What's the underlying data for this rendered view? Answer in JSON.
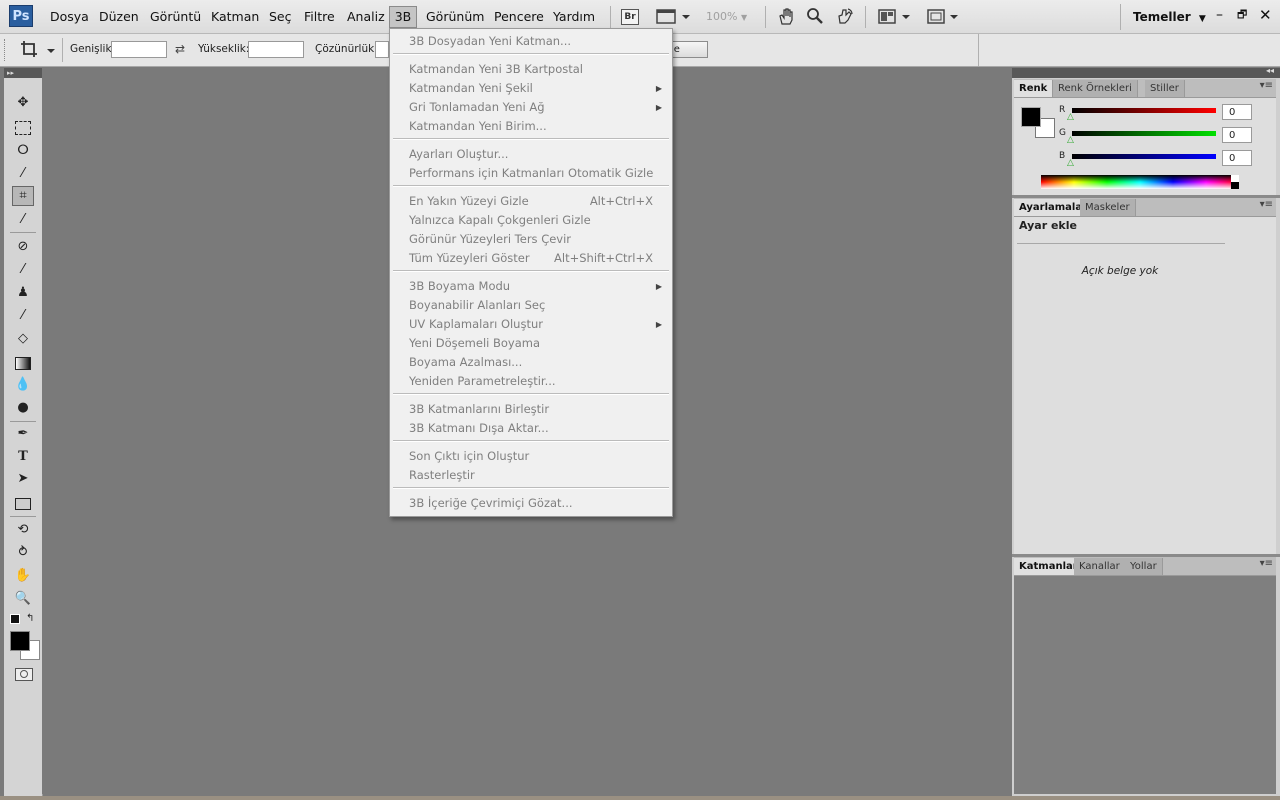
{
  "app": {
    "logo": "Ps"
  },
  "menubar": {
    "items": [
      "Dosya",
      "Düzen",
      "Görüntü",
      "Katman",
      "Seç",
      "Filtre",
      "Analiz",
      "3B",
      "Görünüm",
      "Pencere",
      "Yardım"
    ],
    "zoom": "100%",
    "workspace": "Temeller"
  },
  "options": {
    "width_label": "Genişlik:",
    "height_label": "Yükseklik:",
    "resolution_label": "Çözünürlük:",
    "clear_button_partial": "le"
  },
  "dropdown": {
    "items": [
      {
        "label": "3B Dosyadan Yeni Katman...",
        "shortcut": "",
        "submenu": false
      },
      {
        "label": "Katmandan Yeni 3B Kartpostal",
        "shortcut": "",
        "submenu": false
      },
      {
        "label": "Katmandan Yeni Şekil",
        "shortcut": "",
        "submenu": true
      },
      {
        "label": "Gri Tonlamadan Yeni Ağ",
        "shortcut": "",
        "submenu": true
      },
      {
        "label": "Katmandan Yeni Birim...",
        "shortcut": "",
        "submenu": false
      },
      {
        "label": "Ayarları Oluştur...",
        "shortcut": "",
        "submenu": false
      },
      {
        "label": "Performans için Katmanları Otomatik Gizle",
        "shortcut": "",
        "submenu": false
      },
      {
        "label": "En Yakın Yüzeyi Gizle",
        "shortcut": "Alt+Ctrl+X",
        "submenu": false
      },
      {
        "label": "Yalnızca Kapalı Çokgenleri Gizle",
        "shortcut": "",
        "submenu": false
      },
      {
        "label": "Görünür Yüzeyleri Ters Çevir",
        "shortcut": "",
        "submenu": false
      },
      {
        "label": "Tüm Yüzeyleri Göster",
        "shortcut": "Alt+Shift+Ctrl+X",
        "submenu": false
      },
      {
        "label": "3B Boyama Modu",
        "shortcut": "",
        "submenu": true
      },
      {
        "label": "Boyanabilir Alanları Seç",
        "shortcut": "",
        "submenu": false
      },
      {
        "label": "UV Kaplamaları Oluştur",
        "shortcut": "",
        "submenu": true
      },
      {
        "label": "Yeni Döşemeli Boyama",
        "shortcut": "",
        "submenu": false
      },
      {
        "label": "Boyama Azalması...",
        "shortcut": "",
        "submenu": false
      },
      {
        "label": "Yeniden Parametreleştir...",
        "shortcut": "",
        "submenu": false
      },
      {
        "label": "3B Katmanlarını Birleştir",
        "shortcut": "",
        "submenu": false
      },
      {
        "label": "3B Katmanı Dışa Aktar...",
        "shortcut": "",
        "submenu": false
      },
      {
        "label": "Son Çıktı için Oluştur",
        "shortcut": "",
        "submenu": false
      },
      {
        "label": "Rasterleştir",
        "shortcut": "",
        "submenu": false
      },
      {
        "label": "3B İçeriğe Çevrimiçi Gözat...",
        "shortcut": "",
        "submenu": false
      }
    ]
  },
  "color_panel": {
    "tabs": [
      "Renk",
      "Renk Örnekleri",
      "Stiller"
    ],
    "channels": [
      {
        "name": "R",
        "value": "0",
        "color": "#e00000"
      },
      {
        "name": "G",
        "value": "0",
        "color": "#00c000"
      },
      {
        "name": "B",
        "value": "0",
        "color": "#0000d0"
      }
    ]
  },
  "adjust_panel": {
    "tabs": [
      "Ayarlamalar",
      "Maskeler"
    ],
    "title": "Ayar ekle",
    "empty_text": "Açık belge yok"
  },
  "layers_panel": {
    "tabs": [
      "Katmanlar",
      "Kanallar",
      "Yollar"
    ]
  },
  "colors": {
    "accent": "#2a5e9f",
    "workspace_bg": "#7a7a7a",
    "menu_bg": "#f0f0f0",
    "disabled_text": "#7f7f7f"
  }
}
